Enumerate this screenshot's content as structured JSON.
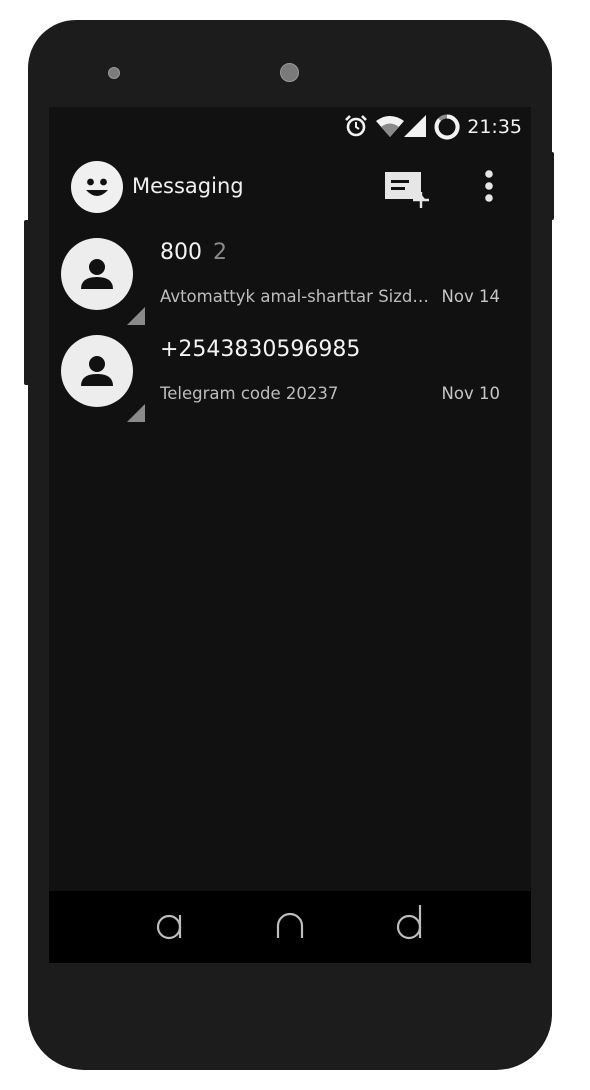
{
  "status_bar": {
    "time": "21:35",
    "icons": [
      "alarm-clock-icon",
      "wifi-icon",
      "cell-signal-icon",
      "battery-ring-icon"
    ]
  },
  "app_bar": {
    "title": "Messaging",
    "logo_icon": "smiley-face-icon",
    "actions": [
      "new-message-icon",
      "overflow-menu-icon"
    ]
  },
  "conversations": [
    {
      "name": "800",
      "count": "2",
      "snippet": "Avtomattyk amal-sharttar Sizdin ...",
      "date": "Nov 14",
      "avatar_icon": "person-icon"
    },
    {
      "name": "+2543830596985",
      "count": "",
      "snippet": "Telegram code 20237",
      "date": "Nov 10",
      "avatar_icon": "person-icon"
    }
  ],
  "nav_bar": {
    "back_glyph": "a",
    "home_glyph": "n",
    "recents_glyph": "d"
  },
  "colors": {
    "screen_background": "#111111",
    "phone_body": "#1c1c1c",
    "nav_background": "#000000",
    "primary_text": "#f3f3f3",
    "secondary_text": "#bdbdbd"
  }
}
